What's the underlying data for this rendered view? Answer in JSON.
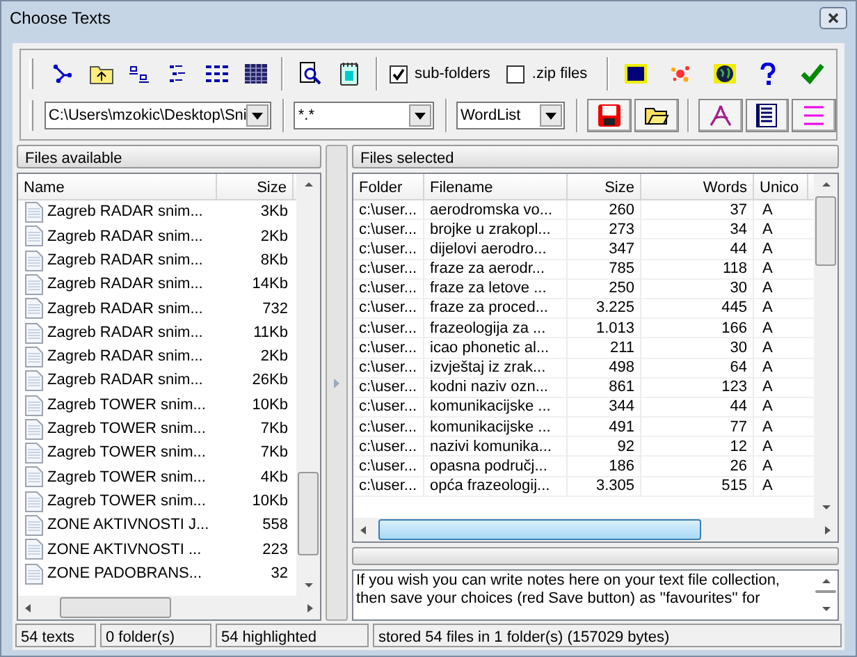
{
  "window": {
    "title": "Choose Texts"
  },
  "options": [
    {
      "label": "sub-folders",
      "checked": true
    },
    {
      "label": ".zip files",
      "checked": false
    }
  ],
  "combos": [
    {
      "kind": "path",
      "value": "C:\\Users\\mzokic\\Desktop\\Sni"
    },
    {
      "kind": "filter",
      "value": "*.*"
    },
    {
      "kind": "tool",
      "value": "WordList"
    }
  ],
  "files_available": {
    "title": "Files available",
    "columns": [
      "Name",
      "Size"
    ],
    "rows": [
      {
        "name": "Zagreb RADAR snim...",
        "size": "3Kb"
      },
      {
        "name": "Zagreb RADAR snim...",
        "size": "2Kb"
      },
      {
        "name": "Zagreb RADAR snim...",
        "size": "8Kb"
      },
      {
        "name": "Zagreb RADAR snim...",
        "size": "14Kb"
      },
      {
        "name": "Zagreb RADAR snim...",
        "size": "732"
      },
      {
        "name": "Zagreb RADAR snim...",
        "size": "11Kb"
      },
      {
        "name": "Zagreb RADAR snim...",
        "size": "2Kb"
      },
      {
        "name": "Zagreb RADAR snim...",
        "size": "26Kb"
      },
      {
        "name": "Zagreb TOWER snim...",
        "size": "10Kb"
      },
      {
        "name": "Zagreb TOWER snim...",
        "size": "7Kb"
      },
      {
        "name": "Zagreb TOWER snim...",
        "size": "7Kb"
      },
      {
        "name": "Zagreb TOWER snim...",
        "size": "4Kb"
      },
      {
        "name": "Zagreb TOWER snim...",
        "size": "10Kb"
      },
      {
        "name": "ZONE AKTIVNOSTI J...",
        "size": "558"
      },
      {
        "name": "ZONE AKTIVNOSTI ...",
        "size": "223"
      },
      {
        "name": "ZONE PADOBRANS...",
        "size": "32"
      }
    ]
  },
  "files_selected": {
    "title": "Files selected",
    "columns": [
      "Folder",
      "Filename",
      "Size",
      "Words",
      "Unico"
    ],
    "rows": [
      {
        "folder": "c:\\user...",
        "filename": "aerodromska vo...",
        "size": "260",
        "words": "37",
        "unicode": "A"
      },
      {
        "folder": "c:\\user...",
        "filename": "brojke u zrakopl...",
        "size": "273",
        "words": "34",
        "unicode": "A"
      },
      {
        "folder": "c:\\user...",
        "filename": "dijelovi aerodro...",
        "size": "347",
        "words": "44",
        "unicode": "A"
      },
      {
        "folder": "c:\\user...",
        "filename": "fraze za aerodr...",
        "size": "785",
        "words": "118",
        "unicode": "A"
      },
      {
        "folder": "c:\\user...",
        "filename": "fraze za letove ...",
        "size": "250",
        "words": "30",
        "unicode": "A"
      },
      {
        "folder": "c:\\user...",
        "filename": "fraze za proced...",
        "size": "3.225",
        "words": "445",
        "unicode": "A"
      },
      {
        "folder": "c:\\user...",
        "filename": "frazeologija za ...",
        "size": "1.013",
        "words": "166",
        "unicode": "A"
      },
      {
        "folder": "c:\\user...",
        "filename": "icao phonetic al...",
        "size": "211",
        "words": "30",
        "unicode": "A"
      },
      {
        "folder": "c:\\user...",
        "filename": "izvještaj iz zrak...",
        "size": "498",
        "words": "64",
        "unicode": "A"
      },
      {
        "folder": "c:\\user...",
        "filename": "kodni naziv ozn...",
        "size": "861",
        "words": "123",
        "unicode": "A"
      },
      {
        "folder": "c:\\user...",
        "filename": "komunikacijske ...",
        "size": "344",
        "words": "44",
        "unicode": "A"
      },
      {
        "folder": "c:\\user...",
        "filename": "komunikacijske ...",
        "size": "491",
        "words": "77",
        "unicode": "A"
      },
      {
        "folder": "c:\\user...",
        "filename": "nazivi komunika...",
        "size": "92",
        "words": "12",
        "unicode": "A"
      },
      {
        "folder": "c:\\user...",
        "filename": "opasna područj...",
        "size": "186",
        "words": "26",
        "unicode": "A"
      },
      {
        "folder": "c:\\user...",
        "filename": "opća frazeologij...",
        "size": "3.305",
        "words": "515",
        "unicode": "A"
      }
    ]
  },
  "notes": {
    "value": "If you wish you can write notes here on your text file collection, then save your choices (red Save button) as ''favourites'' for"
  },
  "status_bar": [
    "54 texts",
    "0 folder(s)",
    "54 highlighted",
    "stored 54 files in 1 folder(s) (157029 bytes)"
  ]
}
